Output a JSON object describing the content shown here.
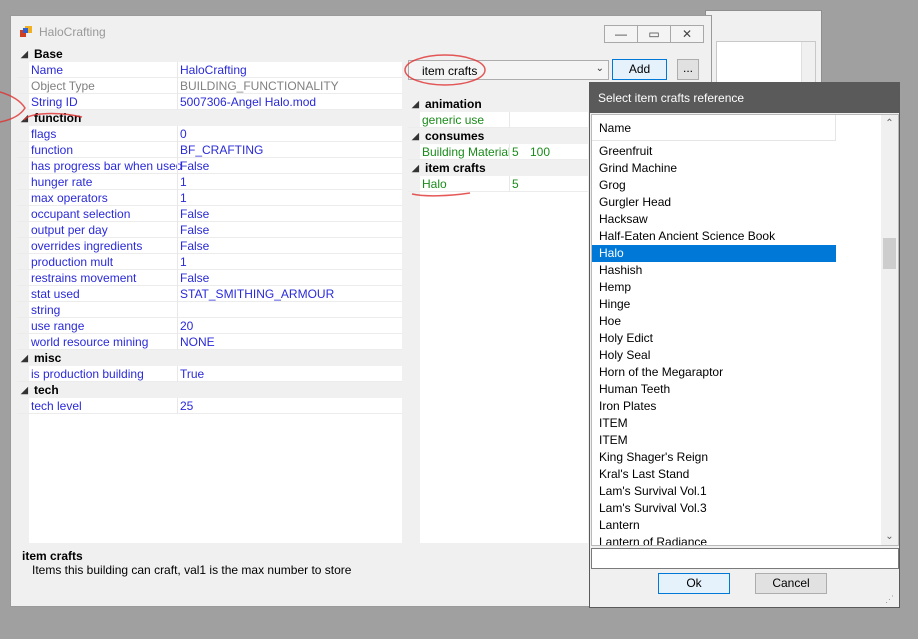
{
  "main_window": {
    "title": "HaloCrafting",
    "controls": {
      "minimize": "—",
      "maximize": "▭",
      "close": "✕"
    }
  },
  "left_grid": {
    "categories": [
      {
        "name": "Base",
        "rows": [
          {
            "label": "Name",
            "value": "HaloCrafting",
            "style": "normal"
          },
          {
            "label": "Object Type",
            "value": "BUILDING_FUNCTIONALITY",
            "style": "gray"
          },
          {
            "label": "String ID",
            "value": "5007306-Angel Halo.mod",
            "style": "normal"
          }
        ]
      },
      {
        "name": "function",
        "rows": [
          {
            "label": "flags",
            "value": "0",
            "style": "normal"
          },
          {
            "label": "function",
            "value": "BF_CRAFTING",
            "style": "normal"
          },
          {
            "label": "has progress bar when used",
            "value": "False",
            "style": "normal"
          },
          {
            "label": "hunger rate",
            "value": "1",
            "style": "normal"
          },
          {
            "label": "max operators",
            "value": "1",
            "style": "normal"
          },
          {
            "label": "occupant selection",
            "value": "False",
            "style": "normal"
          },
          {
            "label": "output per day",
            "value": "False",
            "style": "normal"
          },
          {
            "label": "overrides ingredients",
            "value": "False",
            "style": "normal"
          },
          {
            "label": "production mult",
            "value": "1",
            "style": "normal"
          },
          {
            "label": "restrains movement",
            "value": "False",
            "style": "normal"
          },
          {
            "label": "stat used",
            "value": "STAT_SMITHING_ARMOUR",
            "style": "normal"
          },
          {
            "label": "string",
            "value": "",
            "style": "normal"
          },
          {
            "label": "use range",
            "value": "20",
            "style": "normal"
          },
          {
            "label": "world resource mining",
            "value": "NONE",
            "style": "normal"
          }
        ]
      },
      {
        "name": "misc",
        "rows": [
          {
            "label": "is production building",
            "value": "True",
            "style": "normal"
          }
        ]
      },
      {
        "name": "tech",
        "rows": [
          {
            "label": "tech level",
            "value": "25",
            "style": "normal"
          }
        ]
      }
    ]
  },
  "reference_panel": {
    "combo_value": "item crafts",
    "combo_arrow": "⌄",
    "add_label": "Add",
    "more_label": "...",
    "categories": [
      {
        "name": "animation",
        "rows": [
          {
            "label": "generic use",
            "v1": "",
            "v2": ""
          }
        ]
      },
      {
        "name": "consumes",
        "rows": [
          {
            "label": "Building Material",
            "v1": "5",
            "v2": "100"
          }
        ]
      },
      {
        "name": "item crafts",
        "rows": [
          {
            "label": "Halo",
            "v1": "5",
            "v2": ""
          }
        ]
      }
    ]
  },
  "description": {
    "heading": "item crafts",
    "text": "Items this building can craft, val1 is the max number to store"
  },
  "dialog": {
    "title": "Select item crafts reference",
    "column_header": "Name",
    "items": [
      "Greenfruit",
      "Grind Machine",
      "Grog",
      "Gurgler Head",
      "Hacksaw",
      "Half-Eaten Ancient Science Book",
      "Halo",
      "Hashish",
      "Hemp",
      "Hinge",
      "Hoe",
      "Holy Edict",
      "Holy Seal",
      "Horn of the Megaraptor",
      "Human Teeth",
      "Iron Plates",
      "ITEM",
      "ITEM",
      "King Shager's Reign",
      "Kral's Last Stand",
      "Lam's Survival Vol.1",
      "Lam's Survival Vol.3",
      "Lantern",
      "Lantern of Radiance"
    ],
    "selected_index": 6,
    "filter_value": "",
    "ok_label": "Ok",
    "cancel_label": "Cancel"
  },
  "colors": {
    "link_blue": "#2a2ad8",
    "green_text": "#1a8c1a",
    "selection": "#0078d7",
    "dialog_title_bg": "#5a5a5a",
    "annotation_red": "#e03030"
  },
  "icons": [
    "app-icon",
    "minimize-icon",
    "maximize-icon",
    "close-icon",
    "expand-triangle-icon",
    "dropdown-arrow-icon",
    "scroll-up-icon",
    "scroll-down-icon",
    "resize-grip-icon"
  ]
}
